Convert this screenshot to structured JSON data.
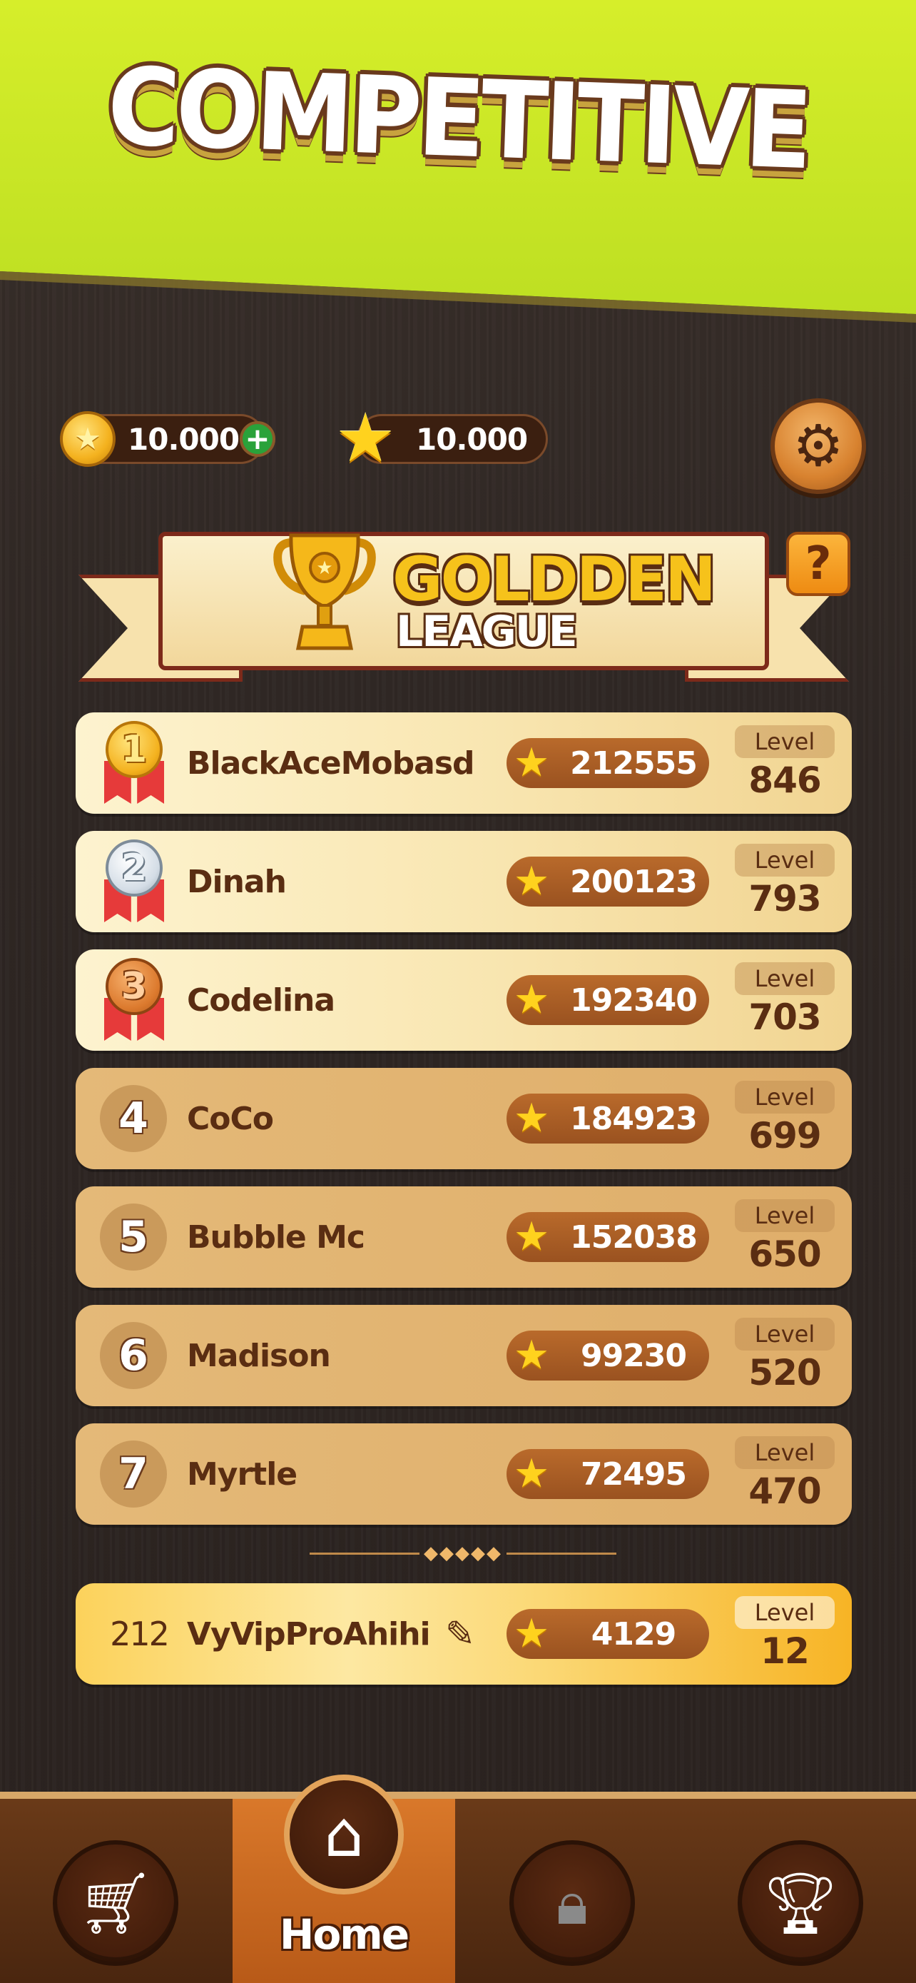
{
  "header": {
    "title": "COMPETITIVE"
  },
  "currency": {
    "coins": "10.000",
    "stars": "10.000",
    "coin_icon": "coin-icon",
    "add_icon": "plus-icon",
    "star_icon": "star-icon",
    "settings_icon": "gear-icon"
  },
  "league": {
    "name_line1": "GOLDDEN",
    "name_line2": "LEAGUE",
    "help_label": "?",
    "trophy_icon": "trophy-icon"
  },
  "leaderboard": {
    "level_label": "Level",
    "rows": [
      {
        "rank": "1",
        "name": "BlackAceMobasd",
        "score": "212555",
        "level": "846",
        "medal": "gold"
      },
      {
        "rank": "2",
        "name": "Dinah",
        "score": "200123",
        "level": "793",
        "medal": "silver"
      },
      {
        "rank": "3",
        "name": "Codelina",
        "score": "192340",
        "level": "703",
        "medal": "bronze"
      },
      {
        "rank": "4",
        "name": "CoCo",
        "score": "184923",
        "level": "699"
      },
      {
        "rank": "5",
        "name": "Bubble Mc",
        "score": "152038",
        "level": "650"
      },
      {
        "rank": "6",
        "name": "Madison",
        "score": "99230",
        "level": "520"
      },
      {
        "rank": "7",
        "name": "Myrtle",
        "score": "72495",
        "level": "470"
      }
    ],
    "me": {
      "rank": "212",
      "name": "VyVipProAhihi",
      "score": "4129",
      "level": "12"
    }
  },
  "nav": {
    "items": [
      {
        "id": "shop",
        "icon": "cart-icon"
      },
      {
        "id": "home",
        "icon": "home-icon",
        "label": "Home",
        "active": true
      },
      {
        "id": "locked",
        "icon": "lock-icon"
      },
      {
        "id": "competitive",
        "icon": "trophy-icon"
      }
    ]
  }
}
